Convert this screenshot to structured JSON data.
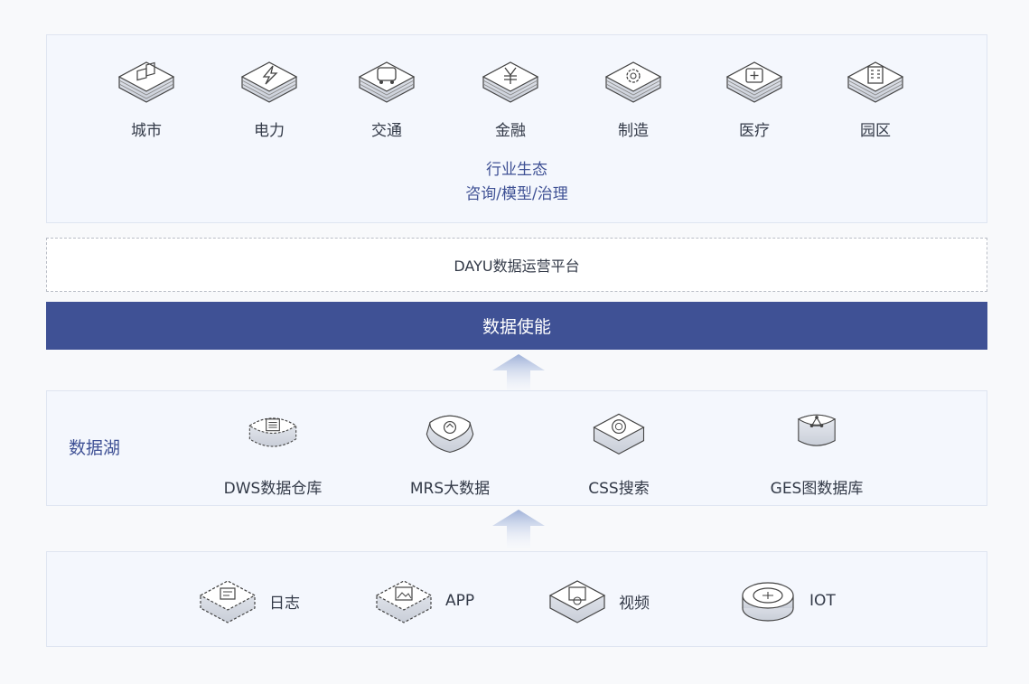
{
  "industry": {
    "items": [
      {
        "label": "城市",
        "icon": "city-icon"
      },
      {
        "label": "电力",
        "icon": "power-icon"
      },
      {
        "label": "交通",
        "icon": "transport-icon"
      },
      {
        "label": "金融",
        "icon": "finance-icon"
      },
      {
        "label": "制造",
        "icon": "manufacturing-icon"
      },
      {
        "label": "医疗",
        "icon": "medical-icon"
      },
      {
        "label": "园区",
        "icon": "park-icon"
      }
    ],
    "caption_line1": "行业生态",
    "caption_line2": "咨询/模型/治理"
  },
  "dayu": {
    "label": "DAYU数据运营平台"
  },
  "enable": {
    "label": "数据使能"
  },
  "lake": {
    "title": "数据湖",
    "items": [
      {
        "label": "DWS数据仓库",
        "icon": "dws-icon"
      },
      {
        "label": "MRS大数据",
        "icon": "mrs-icon"
      },
      {
        "label": "CSS搜索",
        "icon": "css-search-icon"
      },
      {
        "label": "GES图数据库",
        "icon": "ges-graph-icon"
      }
    ]
  },
  "sources": {
    "items": [
      {
        "label": "日志",
        "icon": "log-icon"
      },
      {
        "label": "APP",
        "icon": "app-icon"
      },
      {
        "label": "视频",
        "icon": "video-icon"
      },
      {
        "label": "IOT",
        "icon": "iot-icon"
      }
    ]
  },
  "colors": {
    "accent": "#3f5195",
    "panel_bg": "#f4f7fd",
    "panel_border": "#dfe5f1",
    "text": "#333a48"
  }
}
